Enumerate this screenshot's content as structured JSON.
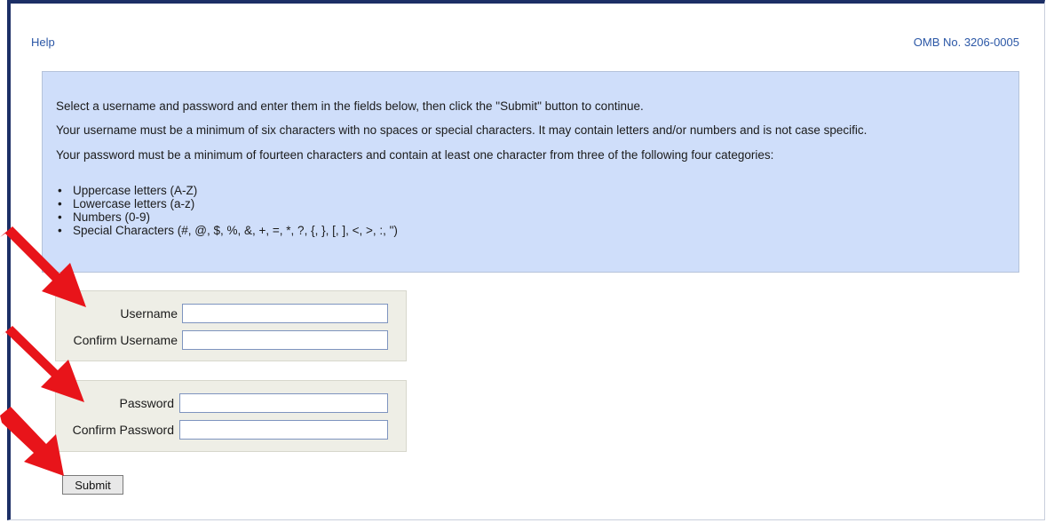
{
  "header": {
    "help_link": "Help",
    "omb_number": "OMB No. 3206-0005"
  },
  "instructions": {
    "line1": "Select a username and password and enter them in the fields below, then click the \"Submit\" button to continue.",
    "line2": "Your username must be a minimum of six characters with no spaces or special characters. It may contain letters and/or numbers and is not case specific.",
    "line3": "Your password must be a minimum of fourteen characters and contain at least one character from three of the following four categories:",
    "categories": [
      "Uppercase letters (A-Z)",
      "Lowercase letters (a-z)",
      "Numbers (0-9)",
      "Special Characters (#, @, $, %, &, +, =, *, ?, {, }, [, ], <, >, :, \")"
    ]
  },
  "username_section": {
    "username_label": "Username",
    "username_value": "",
    "confirm_label": "Confirm Username",
    "confirm_value": ""
  },
  "password_section": {
    "password_label": "Password",
    "password_value": "",
    "confirm_label": "Confirm Password",
    "confirm_value": ""
  },
  "submit_label": "Submit",
  "colors": {
    "frame_border": "#1c2f66",
    "link": "#2b57a6",
    "info_background": "#cfdefa",
    "panel_background": "#eeeee6",
    "annotation_arrow": "#e8141a"
  },
  "annotation_arrows": [
    "username-arrow-icon",
    "password-arrow-icon",
    "submit-arrow-icon"
  ]
}
